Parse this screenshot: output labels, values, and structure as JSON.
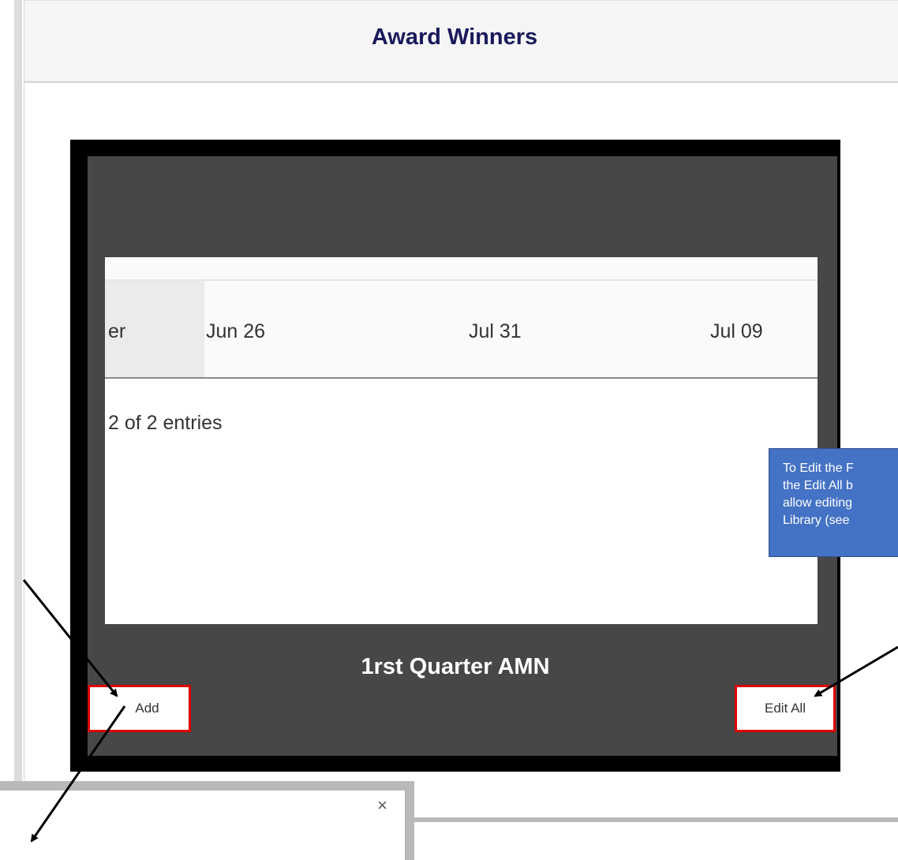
{
  "panel": {
    "title": "Award Winners"
  },
  "table": {
    "header_cells": [
      "er",
      "Jun 26",
      "Jul 31",
      "Jul 09"
    ],
    "entries_text": "2 of 2 entries"
  },
  "card": {
    "title": "1rst Quarter AMN",
    "add_label": "Add",
    "edit_all_label": "Edit All"
  },
  "callout": {
    "lines": [
      "To Edit the F",
      "the Edit All b",
      "allow editing",
      "Library (see"
    ]
  },
  "modal": {
    "close_glyph": "×"
  },
  "colors": {
    "title": "#1a1a5c",
    "card_bg": "#000000",
    "card_inner": "#474747",
    "button_border": "#e00000",
    "callout_bg": "#4472c4"
  }
}
